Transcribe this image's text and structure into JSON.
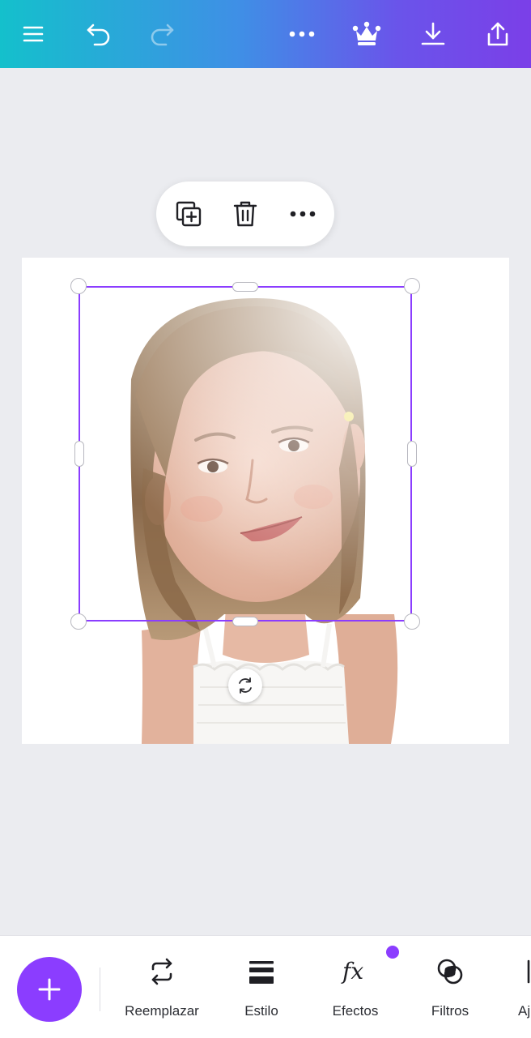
{
  "topbar": {
    "icons": [
      "menu-icon",
      "undo-icon",
      "redo-icon",
      "more-icon",
      "crown-icon",
      "download-icon",
      "share-icon"
    ],
    "redo_enabled": false
  },
  "floating_toolbar": {
    "icons": [
      "duplicate-icon",
      "trash-icon",
      "more-icon"
    ]
  },
  "canvas": {
    "image": "photo of a smiling girl with long light-brown hair wearing a white top",
    "selection_color": "#8b3dff"
  },
  "bottom_toolbar": {
    "add_button_icon": "plus-icon",
    "tools": [
      {
        "label": "Reemplazar",
        "icon": "replace-icon"
      },
      {
        "label": "Estilo",
        "icon": "style-icon"
      },
      {
        "label": "Efectos",
        "icon": "fx-icon",
        "badge": true
      },
      {
        "label": "Filtros",
        "icon": "filters-icon"
      },
      {
        "label": "Aj",
        "icon": "adjust-icon"
      }
    ]
  },
  "colors": {
    "accent": "#8b3dff",
    "canvas_background": "#ebecf0",
    "gradient_start": "#14c0cc",
    "gradient_end": "#7b3fe8"
  }
}
